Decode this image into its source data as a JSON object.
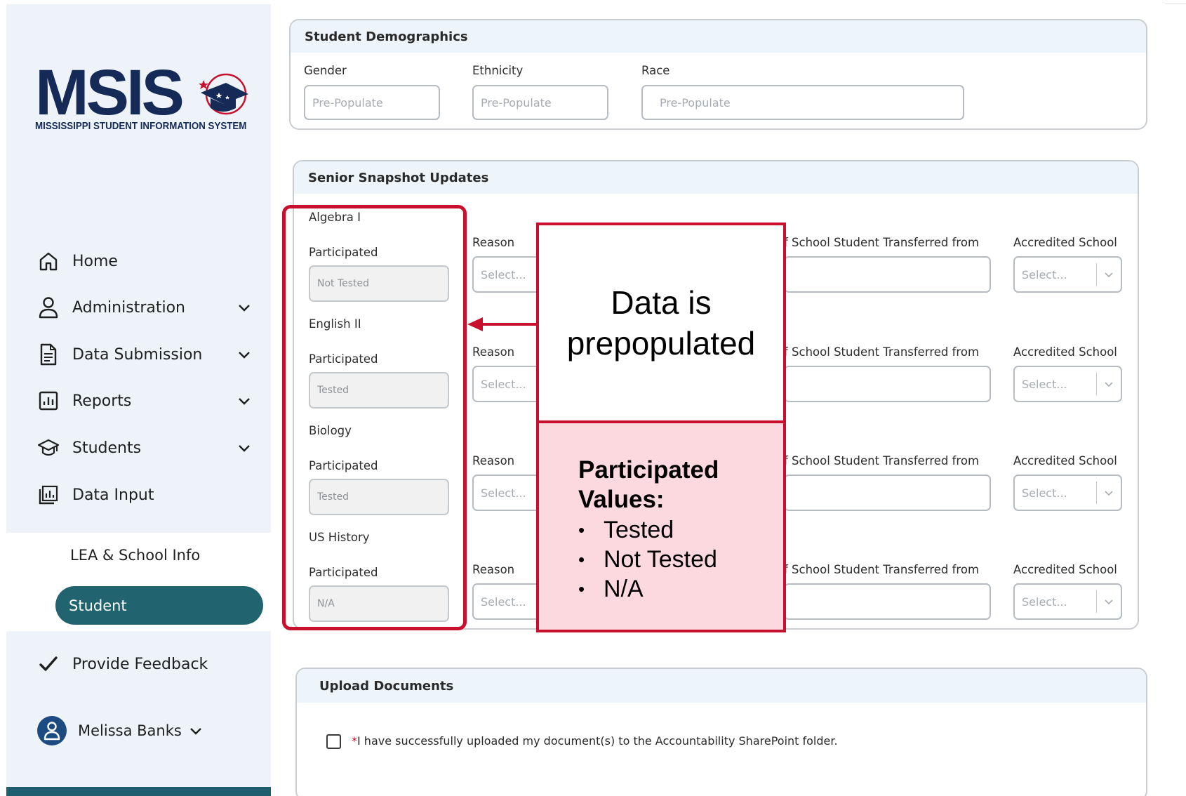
{
  "sidebar": {
    "logo": {
      "wordmark": "MSIS",
      "subtitle": "MISSISSIPPI STUDENT INFORMATION SYSTEM"
    },
    "nav": [
      {
        "label": "Home",
        "icon": "home-icon",
        "expandable": false
      },
      {
        "label": "Administration",
        "icon": "user-icon",
        "expandable": true
      },
      {
        "label": "Data Submission",
        "icon": "document-icon",
        "expandable": true
      },
      {
        "label": "Reports",
        "icon": "bar-chart-icon",
        "expandable": true
      },
      {
        "label": "Students",
        "icon": "graduation-cap-icon",
        "expandable": true
      },
      {
        "label": "Data Input",
        "icon": "data-input-icon",
        "expandable": false
      }
    ],
    "subnav": {
      "lea": "LEA & School Info",
      "student": "Student"
    },
    "feedback": "Provide Feedback",
    "user": "Melissa Banks"
  },
  "demographics": {
    "title": "Student Demographics",
    "fields": [
      {
        "label": "Gender",
        "placeholder": "Pre-Populate"
      },
      {
        "label": "Ethnicity",
        "placeholder": "Pre-Populate"
      },
      {
        "label": "Race",
        "placeholder": "Pre-Populate"
      }
    ]
  },
  "senior": {
    "title": "Senior Snapshot Updates",
    "participated_label": "Participated",
    "reason_label": "Reason",
    "transferred_label": "f School Student Transferred from",
    "accredited_label": "Accredited School",
    "select_placeholder": "Select...",
    "rows": [
      {
        "subject": "Algebra I",
        "participated": "Not Tested"
      },
      {
        "subject": "English II",
        "participated": "Tested"
      },
      {
        "subject": "Biology",
        "participated": "Tested"
      },
      {
        "subject": "US History",
        "participated": "N/A"
      }
    ]
  },
  "upload": {
    "title": "Upload Documents",
    "required_mark": "*",
    "checkbox_label": "I have successfully uploaded my document(s) to the Accountability SharePoint folder."
  },
  "annotation": {
    "callout_line1": "Data is",
    "callout_line2": "prepopulated",
    "values_title_line1": "Participated",
    "values_title_line2": "Values:",
    "values": [
      "Tested",
      "Not Tested",
      "N/A"
    ]
  },
  "colors": {
    "brand_navy": "#152a57",
    "active_teal": "#21646f",
    "annotation_red": "#c8102e",
    "annotation_pink": "#fcd9df",
    "sidebar_bg": "#edf3f9"
  }
}
